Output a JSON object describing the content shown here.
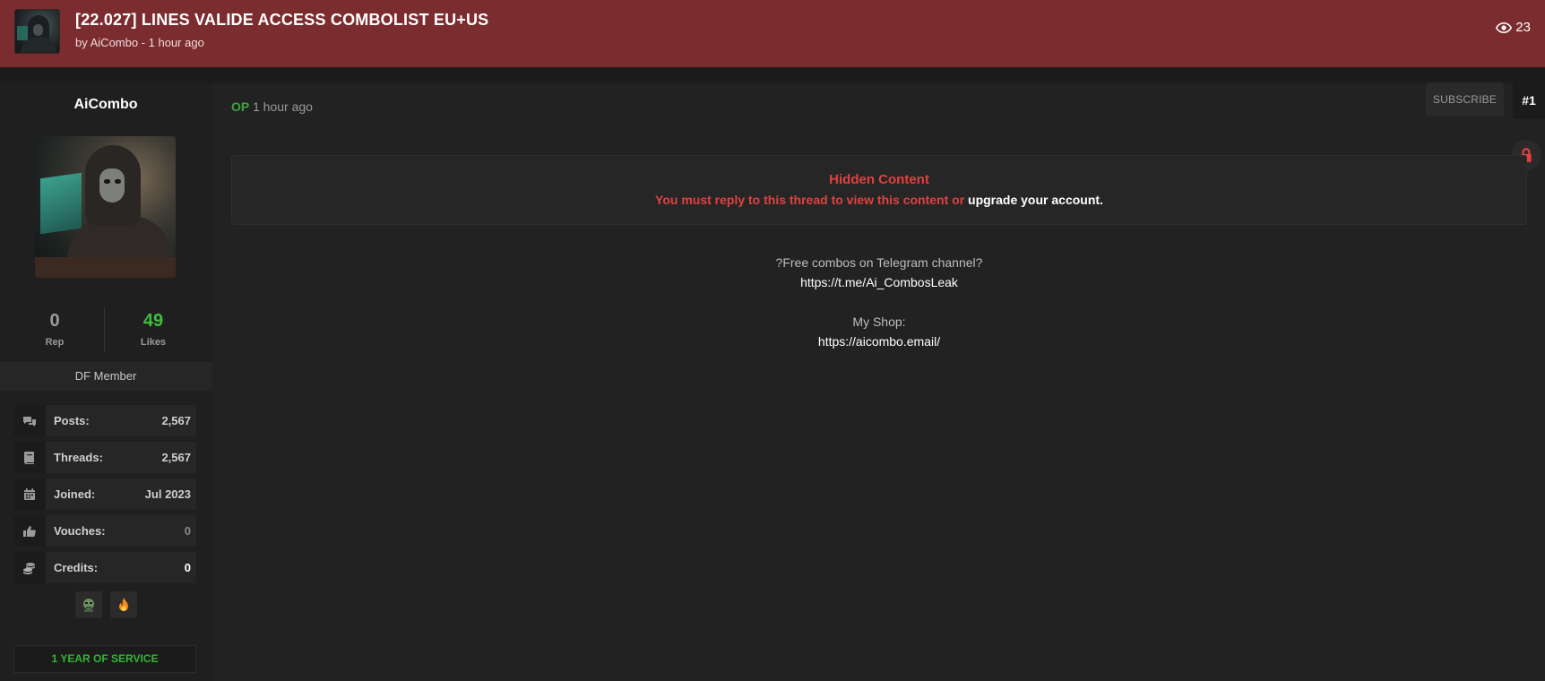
{
  "header": {
    "title": "[22.027] LINES VALIDE ACCESS COMBOLIST EU+US",
    "subtitle": "by AiCombo - 1 hour ago",
    "views": "23"
  },
  "sidebar": {
    "username": "AiCombo",
    "rep": {
      "value": "0",
      "label": "Rep"
    },
    "likes": {
      "value": "49",
      "label": "Likes"
    },
    "rank": "DF Member",
    "stats": [
      {
        "icon": "comments-icon",
        "label": "Posts:",
        "value": "2,567"
      },
      {
        "icon": "book-icon",
        "label": "Threads:",
        "value": "2,567"
      },
      {
        "icon": "calendar-icon",
        "label": "Joined:",
        "value": "Jul 2023"
      },
      {
        "icon": "thumbs-up-icon",
        "label": "Vouches:",
        "value": "0"
      },
      {
        "icon": "coins-icon",
        "label": "Credits:",
        "value": "0"
      }
    ],
    "service": "1 YEAR OF SERVICE"
  },
  "post": {
    "op_label": "OP",
    "time": "1 hour ago",
    "subscribe_label": "SUBSCRIBE",
    "number": "#1",
    "hidden": {
      "title": "Hidden Content",
      "message": "You must reply to this thread to view this content or",
      "link": "upgrade your account."
    },
    "body": {
      "line1": "?Free combos on Telegram channel?",
      "line2": "https://t.me/Ai_CombosLeak",
      "line3": "My Shop:",
      "line4": "https://aicombo.email/"
    }
  },
  "colors": {
    "header_bg": "#7b2c2e",
    "page_bg": "#222222",
    "accent_red": "#e3403f",
    "accent_green": "#3fbf3f"
  }
}
